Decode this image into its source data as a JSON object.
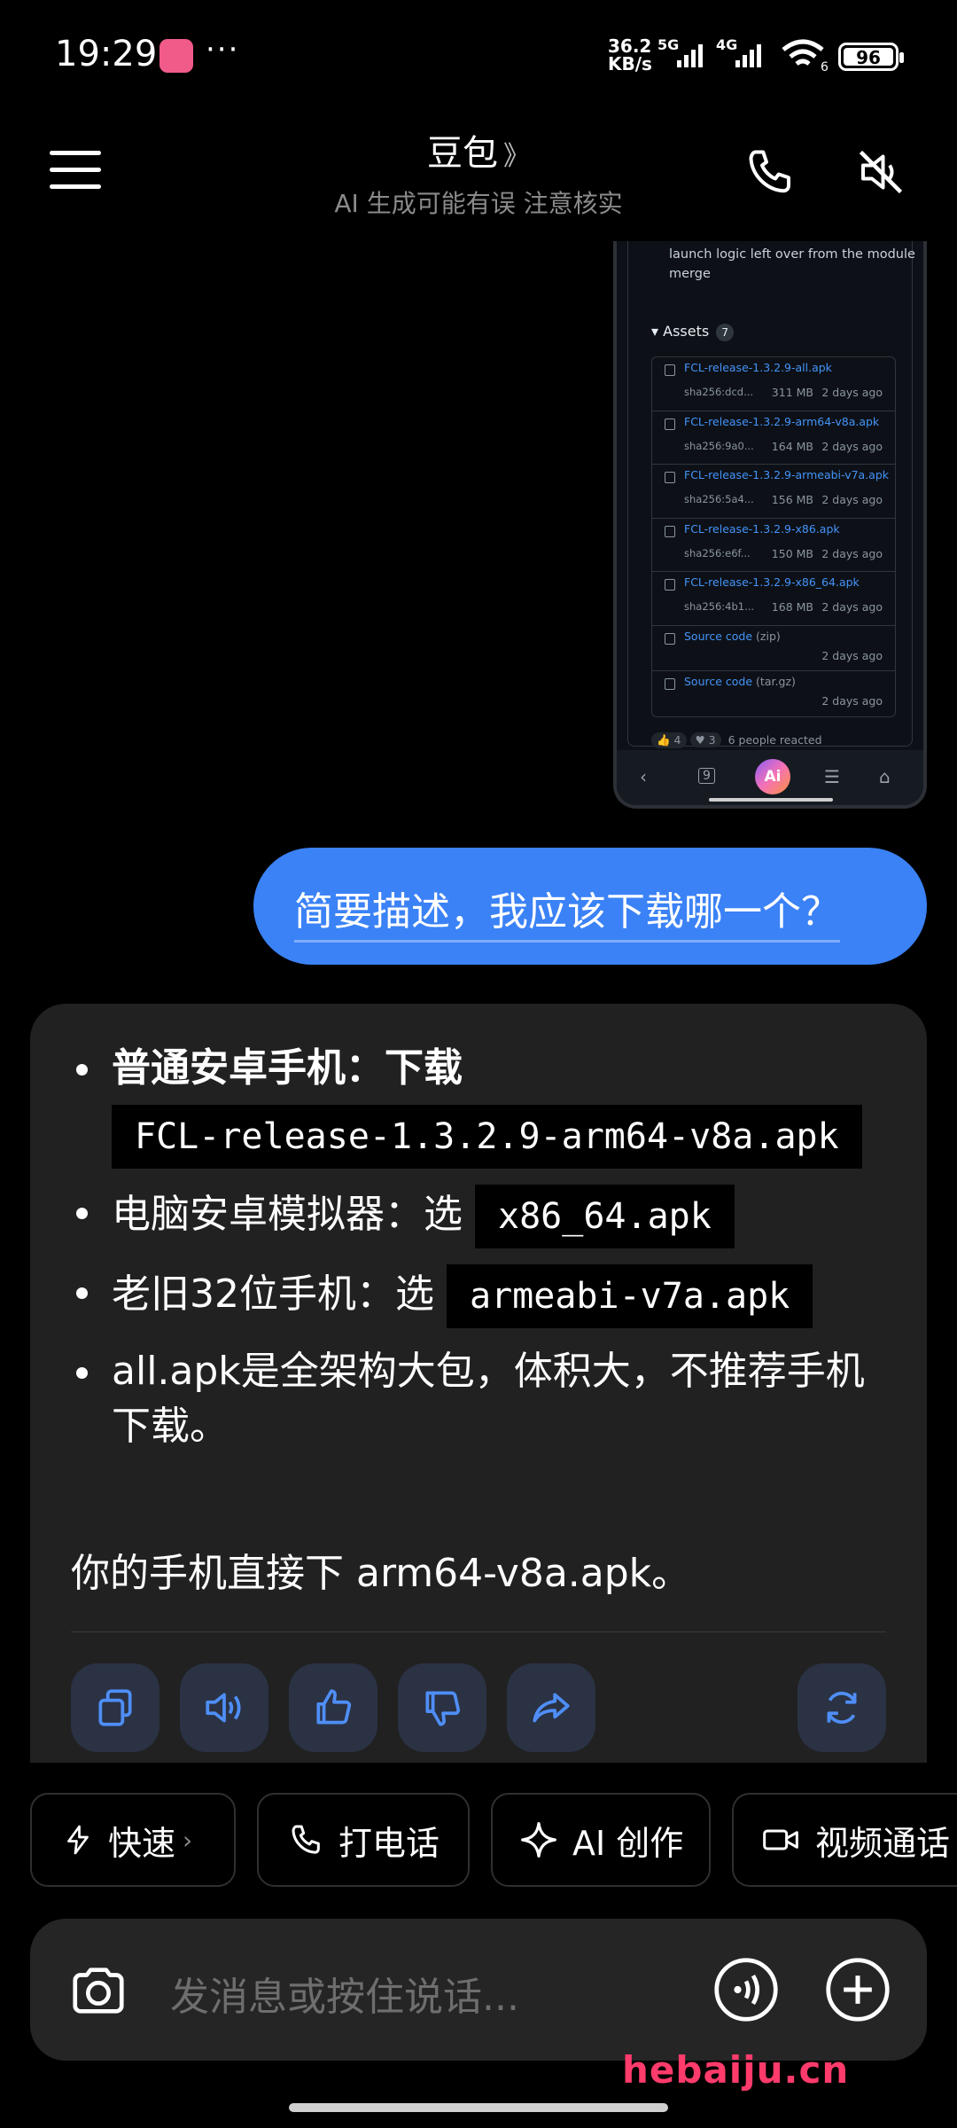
{
  "status_bar": {
    "time": "19:29",
    "dots": "···",
    "net_speed_top": "36.2",
    "net_speed_bottom": "KB/s",
    "sig1": "5G",
    "sig2": "4G",
    "wifi_num": "6",
    "battery": "96"
  },
  "header": {
    "title": "豆包",
    "title_chevron": "》",
    "subtitle": "AI 生成可能有误 注意核实"
  },
  "shared_image": {
    "note": "launch logic left over from the module merge",
    "assets_label": "▾  Assets",
    "assets_count": "7",
    "assets": [
      {
        "name": "FCL-release-1.3.2.9-all.apk",
        "sha": "sha256:dcd...",
        "size": "311 MB",
        "date": "2 days ago"
      },
      {
        "name": "FCL-release-1.3.2.9-arm64-v8a.apk",
        "sha": "sha256:9a0...",
        "size": "164 MB",
        "date": "2 days ago"
      },
      {
        "name": "FCL-release-1.3.2.9-armeabi-v7a.apk",
        "sha": "sha256:5a4...",
        "size": "156 MB",
        "date": "2 days ago"
      },
      {
        "name": "FCL-release-1.3.2.9-x86.apk",
        "sha": "sha256:e6f...",
        "size": "150 MB",
        "date": "2 days ago"
      },
      {
        "name": "FCL-release-1.3.2.9-x86_64.apk",
        "sha": "sha256:4b1...",
        "size": "168 MB",
        "date": "2 days ago"
      }
    ],
    "sources": [
      {
        "name": "Source code",
        "suffix": "(zip)",
        "date": "2 days ago"
      },
      {
        "name": "Source code",
        "suffix": "(tar.gz)",
        "date": "2 days ago"
      }
    ],
    "reaction_thumbs": "👍 4",
    "reaction_heart": "♥ 3",
    "reactions_text": "6 people reacted",
    "nav_ai": "Ai",
    "nav_tab": "9"
  },
  "user_message": "简要描述，我应该下载哪一个？",
  "reply": {
    "b1_label": "普通安卓手机：下载",
    "b1_code": "FCL-release-1.3.2.9-arm64-v8a.apk",
    "b2_label": "电脑安卓模拟器：选",
    "b2_code": "x86_64.apk",
    "b3_label": "老旧32位手机：选",
    "b3_code": "armeabi-v7a.apk",
    "b4_text": "all.apk是全架构大包，体积大，不推荐手机下载。",
    "final": "你的手机直接下 arm64-v8a.apk。"
  },
  "chips": [
    {
      "label": "快速",
      "icon": "bolt-icon",
      "arrow": "›"
    },
    {
      "label": "打电话",
      "icon": "phone-icon"
    },
    {
      "label": "AI 创作",
      "icon": "sparkle-icon"
    },
    {
      "label": "视频通话",
      "icon": "video-icon"
    }
  ],
  "input": {
    "placeholder": "发消息或按住说话..."
  },
  "watermark": "hebaiju.cn",
  "colors": {
    "accent": "#3b82f6",
    "card": "#212121",
    "action_btn": "#2a3244",
    "link": "#4493f8"
  }
}
